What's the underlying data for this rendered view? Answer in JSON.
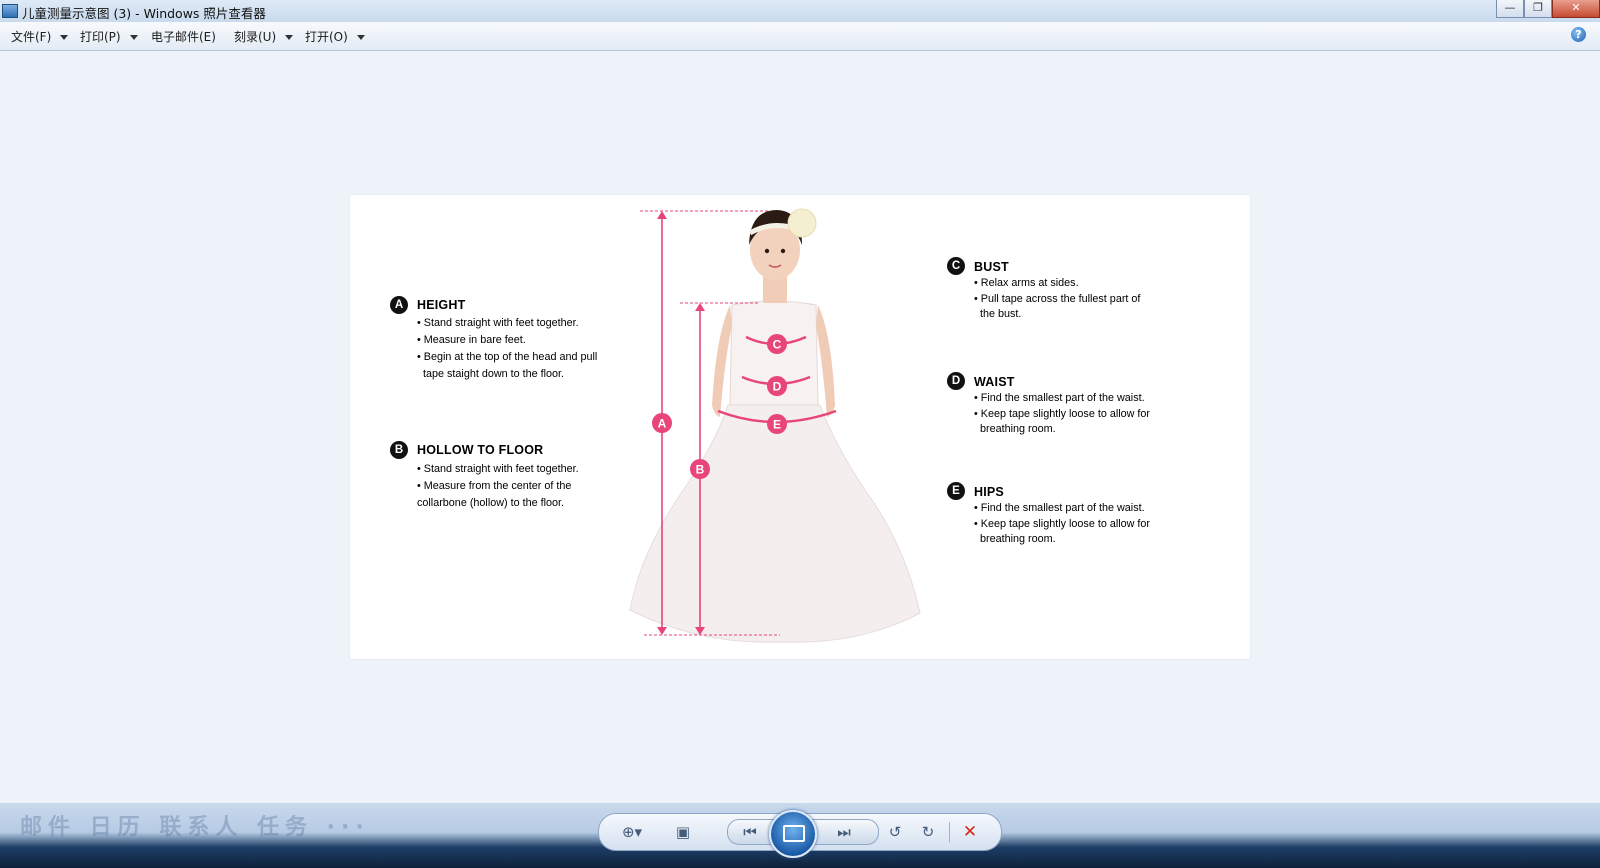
{
  "window": {
    "title": "儿童测量示意图 (3) - Windows 照片查看器",
    "minimize_label": "—",
    "maximize_label": "❐",
    "close_label": "✕"
  },
  "menu": {
    "items": [
      {
        "label": "文件(F)",
        "has_dropdown": true
      },
      {
        "label": "打印(P)",
        "has_dropdown": true
      },
      {
        "label": "电子邮件(E)",
        "has_dropdown": false
      },
      {
        "label": "刻录(U)",
        "has_dropdown": true
      },
      {
        "label": "打开(O)",
        "has_dropdown": true
      }
    ],
    "help_label": "?"
  },
  "photo": {
    "sections": {
      "a": {
        "badge": "A",
        "heading": "HEIGHT",
        "bullets": [
          "• Stand straight with feet together.",
          "• Measure in bare feet.",
          "• Begin at the top of the head and pull",
          "  tape staight down to the floor."
        ]
      },
      "b": {
        "badge": "B",
        "heading": "HOLLOW TO FLOOR",
        "bullets": [
          "• Stand straight with feet together.",
          "• Measure from the center of the",
          "collarbone (hollow) to the floor."
        ]
      },
      "c": {
        "badge": "C",
        "heading": "BUST",
        "bullets": [
          "• Relax arms at sides.",
          "• Pull tape across the fullest part of",
          "  the bust."
        ]
      },
      "d": {
        "badge": "D",
        "heading": "WAIST",
        "bullets": [
          "• Find the smallest part of the waist.",
          "• Keep tape slightly loose to allow for",
          "  breathing room."
        ]
      },
      "e": {
        "badge": "E",
        "heading": "HIPS",
        "bullets": [
          "• Find the smallest part of the waist.",
          "• Keep tape slightly loose to allow for",
          "  breathing room."
        ]
      }
    },
    "markers": {
      "a": "A",
      "b": "B",
      "c": "C",
      "d": "D",
      "e": "E"
    },
    "accent_color": "#e8457a"
  },
  "background_apps": "邮件 日历 联系人 任务 ···",
  "toolbar": {
    "zoom_icon": "zoom-icon",
    "fit_icon": "actual-size-icon",
    "prev_icon": "previous-icon",
    "slideshow_icon": "slideshow-icon",
    "next_icon": "next-icon",
    "rotate_ccw_icon": "rotate-ccw-icon",
    "rotate_cw_icon": "rotate-cw-icon",
    "delete_icon": "delete-icon"
  }
}
